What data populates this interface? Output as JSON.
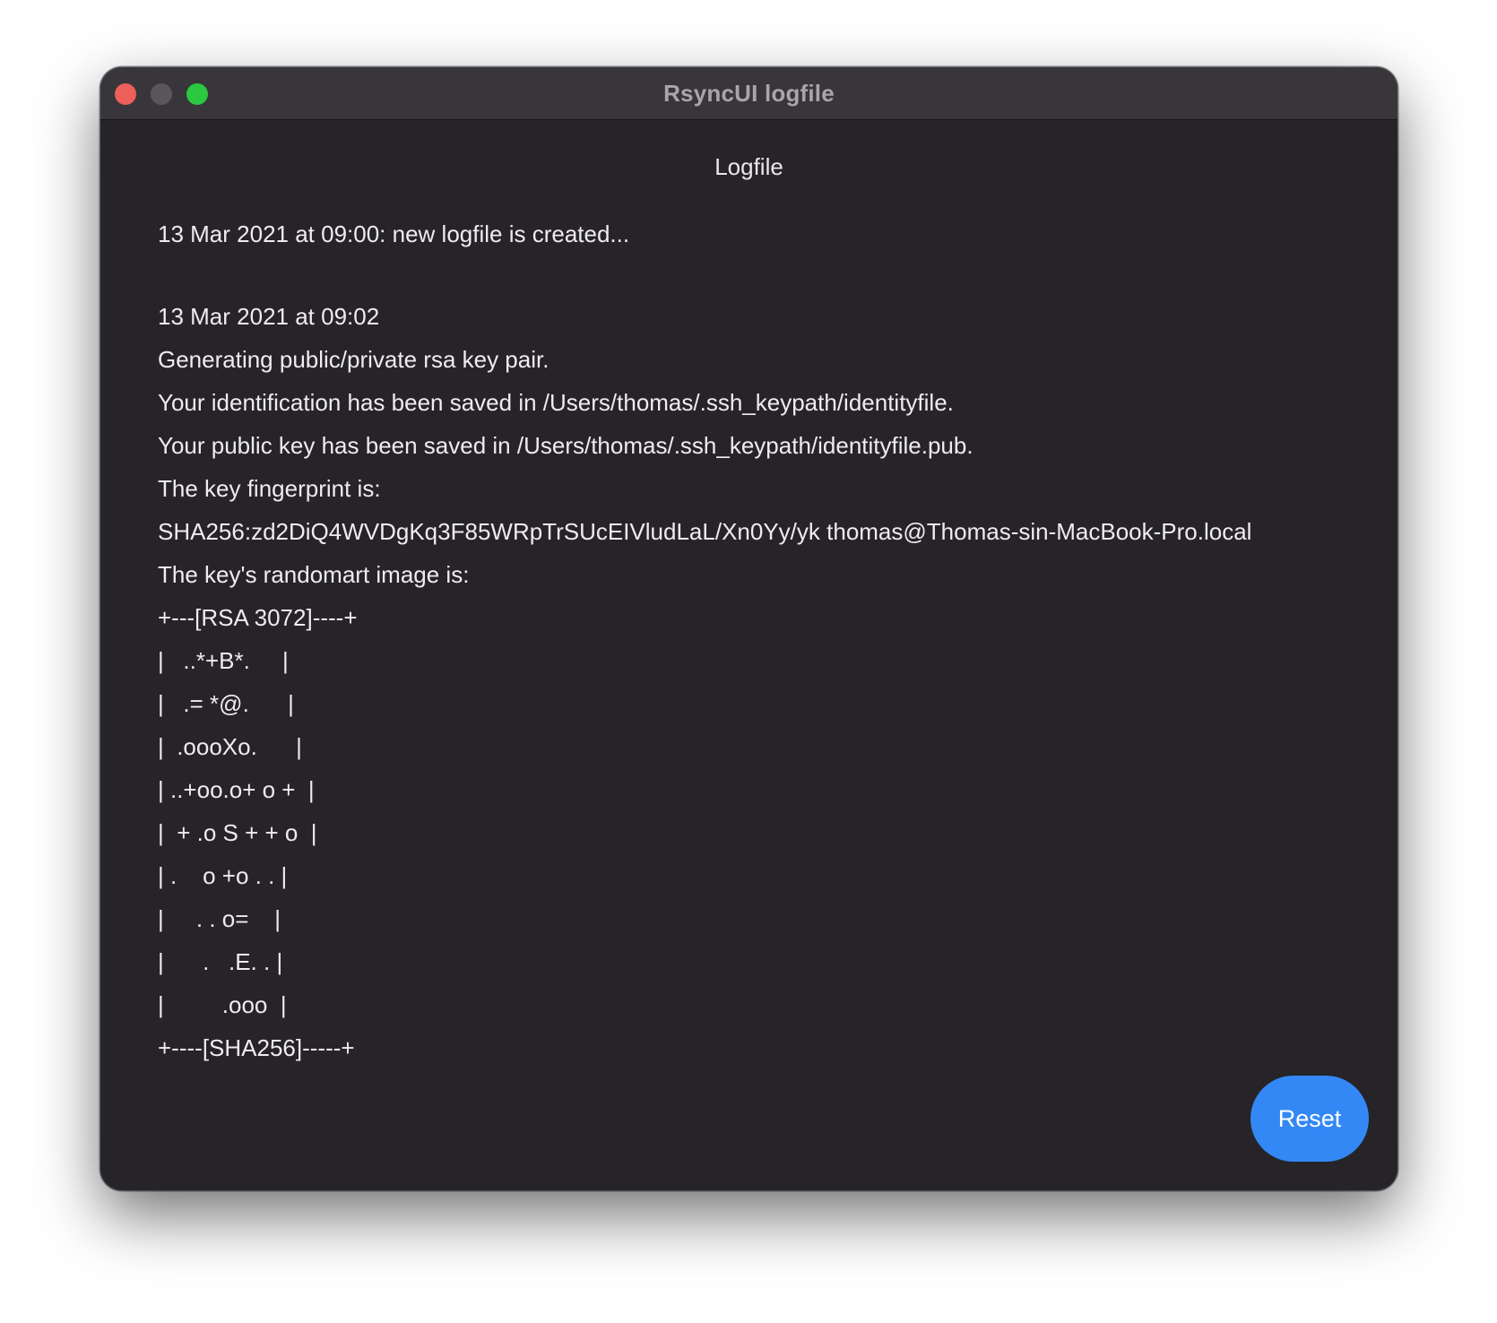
{
  "window": {
    "title": "RsyncUI logfile"
  },
  "heading": "Logfile",
  "log_lines": [
    "13 Mar 2021 at 09:00: new logfile is created...",
    "",
    "13 Mar 2021 at 09:02",
    "Generating public/private rsa key pair.",
    "Your identification has been saved in /Users/thomas/.ssh_keypath/identityfile.",
    "Your public key has been saved in /Users/thomas/.ssh_keypath/identityfile.pub.",
    "The key fingerprint is:",
    "SHA256:zd2DiQ4WVDgKq3F85WRpTrSUcEIVludLaL/Xn0Yy/yk thomas@Thomas-sin-MacBook-Pro.local",
    "The key's randomart image is:",
    "+---[RSA 3072]----+",
    "|   ..*+B*.     |",
    "|   .= *@.      |",
    "|  .oooXo.      |",
    "| ..+oo.o+ o +  |",
    "|  + .o S + + o  |",
    "| .    o +o . . |",
    "|     . . o=    |",
    "|      .   .E. . |",
    "|         .ooo  |",
    "+----[SHA256]-----+"
  ],
  "buttons": {
    "reset_label": "Reset"
  },
  "colors": {
    "accent": "#3388f5",
    "close": "#ec5f5a",
    "minimize": "#59575b",
    "zoom": "#2cc840",
    "background": "#262428"
  }
}
